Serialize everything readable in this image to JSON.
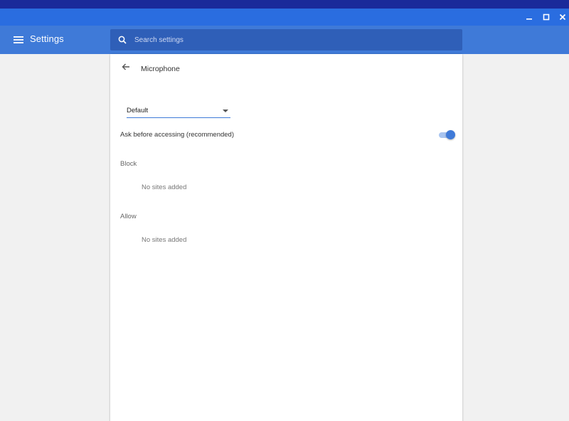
{
  "window": {
    "controls": {
      "minimize_icon": "minimize-icon",
      "maximize_icon": "maximize-icon",
      "close_icon": "close-icon"
    }
  },
  "appbar": {
    "title": "Settings",
    "menu_icon": "hamburger-menu-icon",
    "search": {
      "placeholder": "Search settings",
      "value": "",
      "icon": "search-icon"
    }
  },
  "page": {
    "title": "Microphone",
    "back_icon": "back-arrow-icon",
    "device_select": {
      "selected": "Default"
    },
    "ask_before": {
      "label": "Ask before accessing (recommended)",
      "enabled": true
    },
    "block": {
      "heading": "Block",
      "empty_text": "No sites added"
    },
    "allow": {
      "heading": "Allow",
      "empty_text": "No sites added"
    }
  },
  "colors": {
    "accent": "#3f7ad8",
    "titlebar": "#2a6de0",
    "search_bg": "#2f5fb8",
    "background": "#f1f1f1"
  }
}
